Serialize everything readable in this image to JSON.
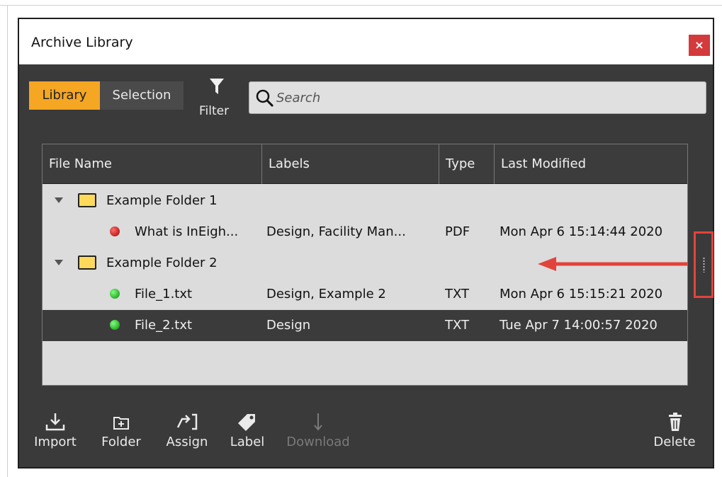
{
  "window": {
    "title": "Archive Library",
    "close_label": "×"
  },
  "tabs": [
    {
      "label": "Library",
      "active": true
    },
    {
      "label": "Selection",
      "active": false
    }
  ],
  "filter": {
    "label": "Filter"
  },
  "search": {
    "placeholder": "Search",
    "value": ""
  },
  "table": {
    "columns": [
      "File Name",
      "Labels",
      "Type",
      "Last Modified"
    ],
    "rows": [
      {
        "kind": "folder",
        "name": "Example Folder 1"
      },
      {
        "kind": "file",
        "status": "red",
        "name": "What is InEigh...",
        "labels": "Design, Facility Man...",
        "type": "PDF",
        "modified": "Mon Apr 6 15:14:44 2020"
      },
      {
        "kind": "folder",
        "name": "Example Folder 2"
      },
      {
        "kind": "file",
        "status": "green",
        "name": "File_1.txt",
        "labels": "Design, Example 2",
        "type": "TXT",
        "modified": "Mon Apr 6 15:15:21 2020"
      },
      {
        "kind": "file",
        "status": "green",
        "name": "File_2.txt",
        "labels": "Design",
        "type": "TXT",
        "modified": "Tue Apr 7 14:00:57 2020",
        "selected": true
      }
    ]
  },
  "toolbar": {
    "import": "Import",
    "folder": "Folder",
    "assign": "Assign",
    "label": "Label",
    "download": "Download",
    "delete": "Delete"
  },
  "colors": {
    "accent": "#f5a623",
    "annotation": "#e2443b",
    "status_red": "#c00000",
    "status_green": "#17a317"
  }
}
